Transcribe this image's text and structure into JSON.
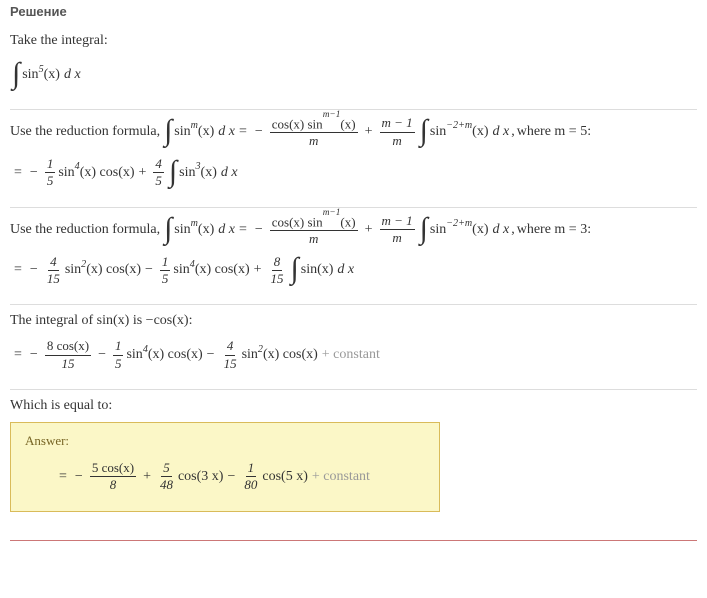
{
  "heading": "Решение",
  "step0": {
    "text": "Take the integral:",
    "expr_intpow": "5",
    "expr_arg": "(x)",
    "expr_dx": "d x"
  },
  "step1": {
    "text_pre": "Use the reduction formula, ",
    "m_sub": "where m = 5:",
    "formula_intpow": "m",
    "formula_arg": "(x)",
    "formula_dx": "d x",
    "formula_num1": "cos(x) sin",
    "formula_num1_pow": "m−1",
    "formula_num1_arg": "(x)",
    "formula_den1": "m",
    "formula_num2": "m − 1",
    "formula_den2": "m",
    "formula_int2pow": "−2+m",
    "result_f1n": "1",
    "result_f1d": "5",
    "result_t1": "sin",
    "result_t1p": "4",
    "result_t1a": "(x) cos(x)",
    "result_f2n": "4",
    "result_f2d": "5",
    "result_intpow": "3"
  },
  "step2": {
    "text_pre": "Use the reduction formula, ",
    "m_sub": "where m = 3:",
    "result_f1n": "4",
    "result_f1d": "15",
    "result_t1": "sin",
    "result_t1p": "2",
    "result_t1a": "(x) cos(x)",
    "result_f2n": "1",
    "result_f2d": "5",
    "result_t2": "sin",
    "result_t2p": "4",
    "result_t2a": "(x) cos(x)",
    "result_f3n": "8",
    "result_f3d": "15",
    "result_int": "sin(x)"
  },
  "step3": {
    "text": "The integral of sin(x) is −cos(x):",
    "f1n": "8 cos(x)",
    "f1d": "15",
    "f2n": "1",
    "f2d": "5",
    "t2": "sin",
    "t2p": "4",
    "t2a": "(x) cos(x)",
    "f3n": "4",
    "f3d": "15",
    "t3": "sin",
    "t3p": "2",
    "t3a": "(x) cos(x)",
    "const": "+ constant"
  },
  "step4": {
    "text": "Which is equal to:",
    "label": "Answer:",
    "f1n": "5 cos(x)",
    "f1d": "8",
    "f2n": "5",
    "f2d": "48",
    "t2": "cos(3 x)",
    "f3n": "1",
    "f3d": "80",
    "t3": "cos(5 x)",
    "const": "+ constant"
  },
  "sym": {
    "eq": "=",
    "minus": "−",
    "plus": "+",
    "comma": ", ",
    "sin": "sin",
    "cos": "cos",
    "dx": "d x",
    "arg": "(x)"
  }
}
